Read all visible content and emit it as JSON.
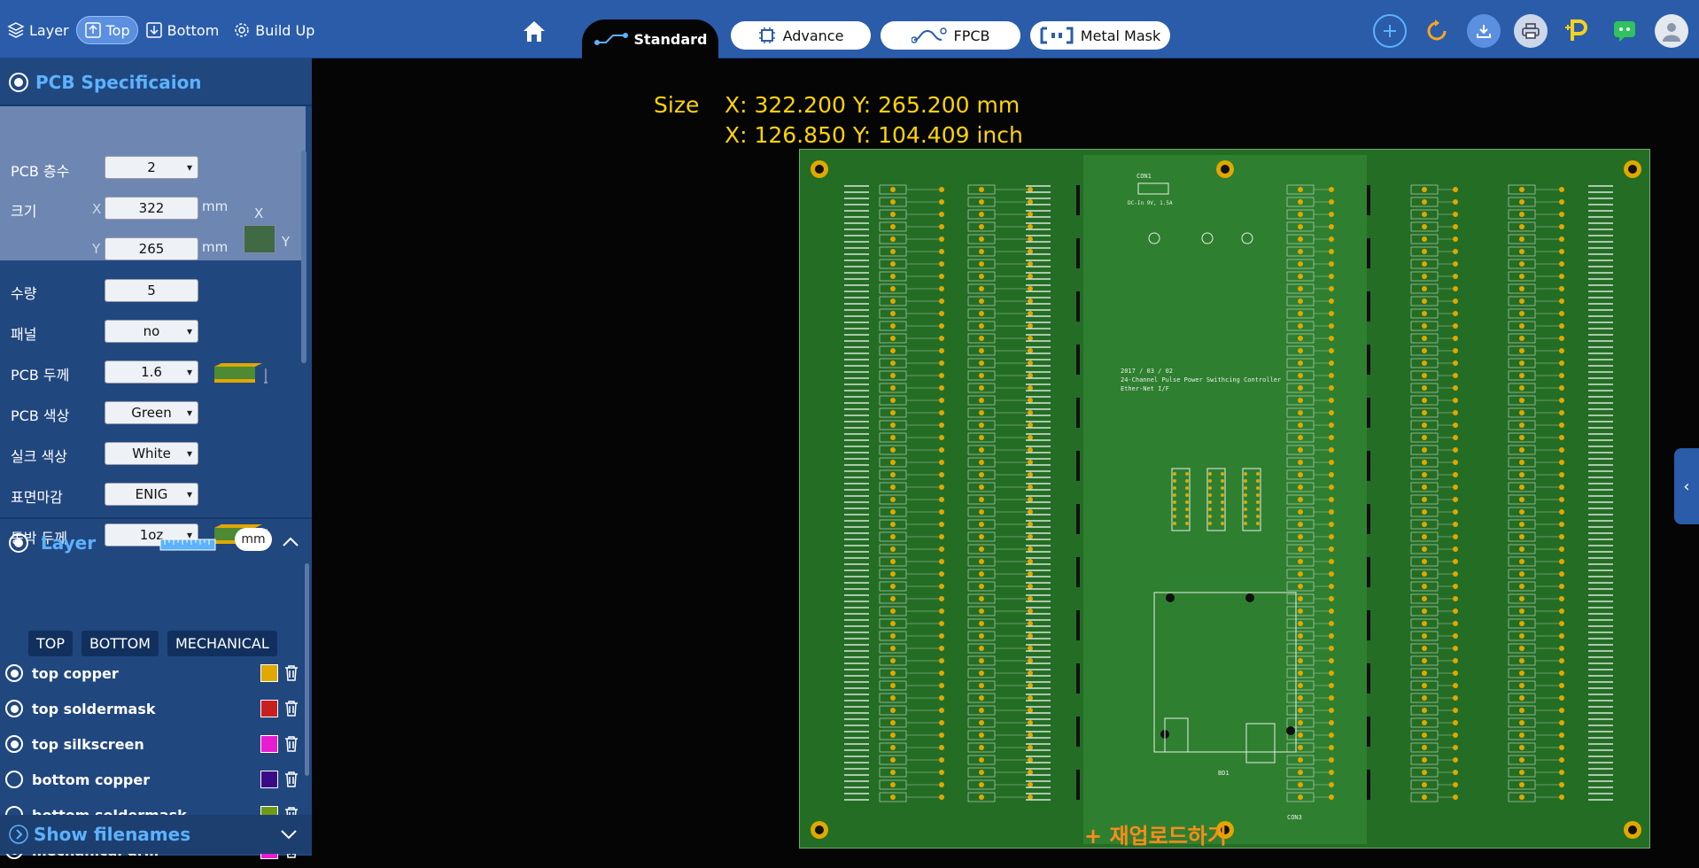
{
  "toolbar": {
    "layer": "Layer",
    "top": "Top",
    "bottom": "Bottom",
    "buildup": "Build Up"
  },
  "tabs": {
    "standard": "Standard",
    "advance": "Advance",
    "fpcb": "FPCB",
    "metal_mask": "Metal Mask"
  },
  "spec": {
    "title": "PCB Specificaion",
    "layers_label": "PCB 층수",
    "layers_value": "2",
    "size_label": "크기",
    "x_label": "X",
    "x_value": "322",
    "y_label": "Y",
    "y_value": "265",
    "unit_mm": "mm",
    "qty_label": "수량",
    "qty_value": "5",
    "panel_label": "패널",
    "panel_value": "no",
    "thickness_label": "PCB 두께",
    "thickness_value": "1.6",
    "color_label": "PCB 색상",
    "color_value": "Green",
    "silk_label": "실크 색상",
    "silk_value": "White",
    "finish_label": "표면마감",
    "finish_value": "ENIG",
    "copper_label": "동박 두께",
    "copper_value": "1oz"
  },
  "layer_panel": {
    "title": "Layer",
    "unit_toggle": "mm",
    "filter_buttons": [
      "TOP",
      "BOTTOM",
      "MECHANICAL"
    ],
    "layers": [
      {
        "name": "top copper",
        "color": "#e0a800",
        "checked": true
      },
      {
        "name": "top soldermask",
        "color": "#c8201e",
        "checked": true
      },
      {
        "name": "top silkscreen",
        "color": "#e81cd1",
        "checked": true
      },
      {
        "name": "bottom copper",
        "color": "#3b0a86",
        "checked": false
      },
      {
        "name": "bottom soldermask",
        "color": "#6f9a18",
        "checked": false
      },
      {
        "name": "mechanical drill",
        "color": "#e81cd1",
        "checked": true
      }
    ],
    "show_filenames": "Show filenames"
  },
  "viewer": {
    "size_label": "Size",
    "size_mm": "X: 322.200 Y: 265.200 mm",
    "size_inch": "X: 126.850 Y: 104.409 inch",
    "reload": "+ 재업로드하기"
  },
  "board_text": {
    "date": "2017 / 03 / 02",
    "desc": "24-Channel Pulse Power Swithcing Controller",
    "desc2": "Ether-Net I/F",
    "conn": "CON1",
    "power": "DC-In 9V, 1.5A",
    "con3": "CON3",
    "bd1": "BD1"
  },
  "colors": {
    "accent": "#2a5caa",
    "board": "#246d25",
    "size_text": "#ffd400",
    "reload_text": "#ff8c1a"
  }
}
